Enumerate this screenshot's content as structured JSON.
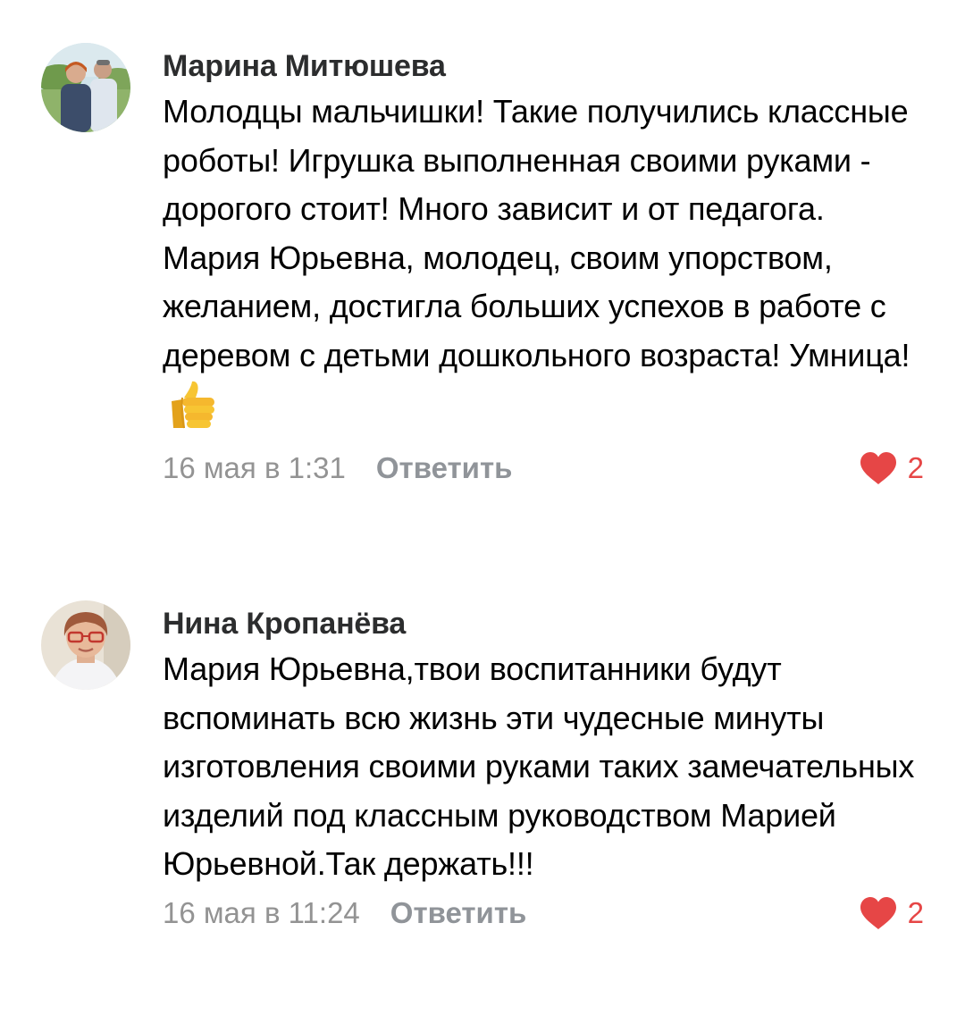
{
  "comments": [
    {
      "author": "Марина Митюшева",
      "text": "Молодцы мальчишки! Такие получились классные роботы! Игрушка выполненная своими руками - дорогого стоит! Много зависит и от педагога. Мария Юрьевна, молодец, своим упорством, желанием, достигла больших успехов в работе с деревом с детьми дошкольного возраста! Умница!",
      "emoji": "thumbs-up-emoji",
      "date": "16 мая в 1:31",
      "reply_label": "Ответить",
      "likes": "2"
    },
    {
      "author": "Нина Кропанёва",
      "text": "Мария Юрьевна,твои воспитанники будут вспоминать всю жизнь эти чудесные минуты изготовления своими руками таких замечательных изделий под классным руководством Марией Юрьевной.Так держать!!!",
      "date": "16 мая в 11:24",
      "reply_label": "Ответить",
      "likes": "2"
    }
  ],
  "icons": {
    "like": "heart-icon"
  },
  "colors": {
    "heart": "#e64646",
    "meta_text": "#939393",
    "reply_text": "#909499",
    "author_text": "#2c2d2e"
  }
}
